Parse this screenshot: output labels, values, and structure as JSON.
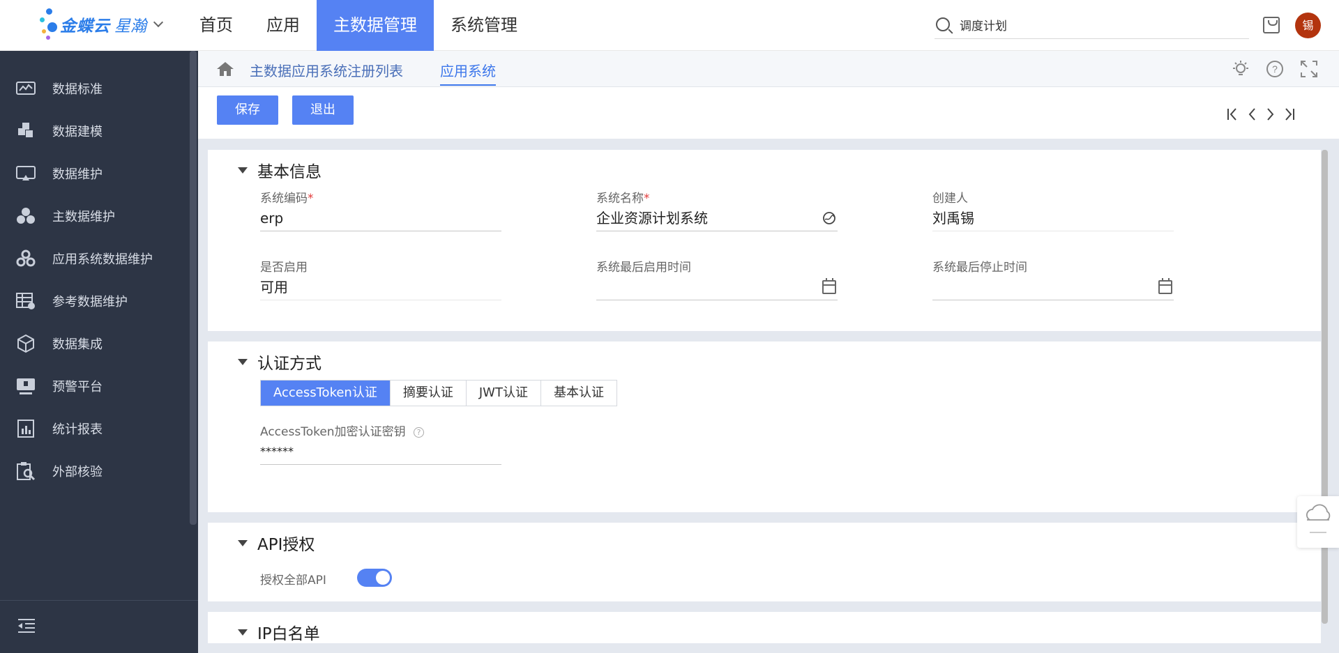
{
  "app": {
    "brand_name": "金蝶云",
    "brand_sub": "星瀚",
    "colors": {
      "accent": "#5582f3",
      "sidebar_bg": "#2d3545",
      "avatar_bg": "#b3340e",
      "required": "#e23b3b"
    }
  },
  "topnav": {
    "items": [
      {
        "label": "首页"
      },
      {
        "label": "应用"
      },
      {
        "label": "主数据管理",
        "active": true
      },
      {
        "label": "系统管理"
      }
    ],
    "search_value": "调度计划",
    "avatar_text": "锡"
  },
  "sidebar": {
    "items": [
      {
        "label": "数据标准",
        "icon": "chart-monitor-icon"
      },
      {
        "label": "数据建模",
        "icon": "blocks-icon"
      },
      {
        "label": "数据维护",
        "icon": "screen-icon"
      },
      {
        "label": "主数据维护",
        "icon": "cluster-icon"
      },
      {
        "label": "应用系统数据维护",
        "icon": "gears-cluster-icon"
      },
      {
        "label": "参考数据维护",
        "icon": "table-gear-icon"
      },
      {
        "label": "数据集成",
        "icon": "cube-icon"
      },
      {
        "label": "预警平台",
        "icon": "alert-screen-icon"
      },
      {
        "label": "统计报表",
        "icon": "report-icon"
      },
      {
        "label": "外部核验",
        "icon": "clipboard-search-icon"
      }
    ]
  },
  "breadcrumb": {
    "items": [
      {
        "label": "主数据应用系统注册列表"
      },
      {
        "label": "应用系统",
        "active": true
      }
    ]
  },
  "toolbar": {
    "save_label": "保存",
    "exit_label": "退出"
  },
  "basic_info": {
    "title": "基本信息",
    "system_code": {
      "label": "系统编码",
      "required": "*",
      "value": "erp"
    },
    "system_name": {
      "label": "系统名称",
      "required": "*",
      "value": "企业资源计划系统"
    },
    "creator": {
      "label": "创建人",
      "value": "刘禹锡"
    },
    "enabled": {
      "label": "是否启用",
      "value": "可用"
    },
    "last_enable_time": {
      "label": "系统最后启用时间",
      "value": ""
    },
    "last_disable_time": {
      "label": "系统最后停止时间",
      "value": ""
    }
  },
  "auth": {
    "title": "认证方式",
    "tabs": [
      {
        "label": "AccessToken认证",
        "active": true
      },
      {
        "label": "摘要认证"
      },
      {
        "label": "JWT认证"
      },
      {
        "label": "基本认证"
      }
    ],
    "secret": {
      "label": "AccessToken加密认证密钥",
      "value": "******"
    }
  },
  "api": {
    "title": "API授权",
    "authorize_all": {
      "label": "授权全部API",
      "on": true
    }
  },
  "ip": {
    "title": "IP白名单"
  }
}
